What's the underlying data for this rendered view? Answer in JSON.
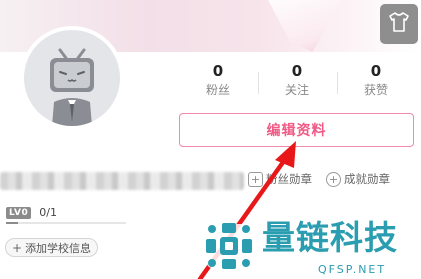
{
  "stats": [
    {
      "count": "0",
      "label": "粉丝"
    },
    {
      "count": "0",
      "label": "关注"
    },
    {
      "count": "0",
      "label": "获赞"
    }
  ],
  "edit_profile_label": "编辑资料",
  "medals": {
    "fan_medal_label": "粉丝勋章",
    "achievement_medal_label": "成就勋章"
  },
  "level": {
    "badge": "LV0",
    "exp": "0/1",
    "progress": 0.1
  },
  "school": {
    "label": "添加学校信息"
  },
  "watermark": {
    "title": "量链科技",
    "subtitle": "QFSP.NET"
  },
  "icons": {
    "theme": "tshirt-icon",
    "avatar": "tv-mascot-icon",
    "fan_medal": "medal-plus-icon",
    "achievement_medal": "medal-plus-icon"
  },
  "colors": {
    "accent": "#f05a85",
    "annotation_arrow": "#e8181a",
    "watermark": "#2a9db0"
  }
}
